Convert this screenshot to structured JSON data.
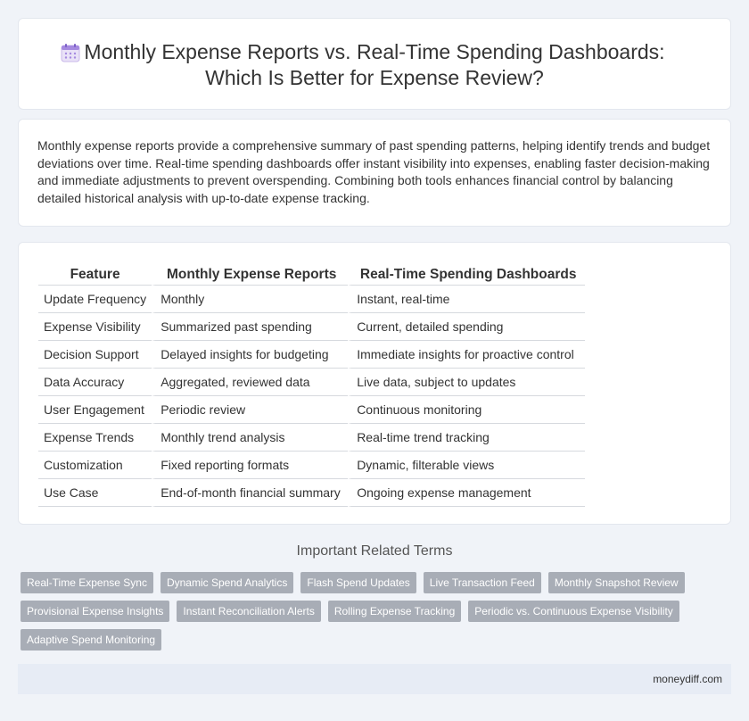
{
  "header": {
    "title_line1": "Monthly Expense Reports vs. Real-Time Spending Dashboards:",
    "title_line2": "Which Is Better for Expense Review?",
    "icon": "calendar-icon"
  },
  "intro": {
    "text": "Monthly expense reports provide a comprehensive summary of past spending patterns, helping identify trends and budget deviations over time. Real-time spending dashboards offer instant visibility into expenses, enabling faster decision-making and immediate adjustments to prevent overspending. Combining both tools enhances financial control by balancing detailed historical analysis with up-to-date expense tracking."
  },
  "table": {
    "headers": [
      "Feature",
      "Monthly Expense Reports",
      "Real-Time Spending Dashboards"
    ],
    "rows": [
      [
        "Update Frequency",
        "Monthly",
        "Instant, real-time"
      ],
      [
        "Expense Visibility",
        "Summarized past spending",
        "Current, detailed spending"
      ],
      [
        "Decision Support",
        "Delayed insights for budgeting",
        "Immediate insights for proactive control"
      ],
      [
        "Data Accuracy",
        "Aggregated, reviewed data",
        "Live data, subject to updates"
      ],
      [
        "User Engagement",
        "Periodic review",
        "Continuous monitoring"
      ],
      [
        "Expense Trends",
        "Monthly trend analysis",
        "Real-time trend tracking"
      ],
      [
        "Customization",
        "Fixed reporting formats",
        "Dynamic, filterable views"
      ],
      [
        "Use Case",
        "End-of-month financial summary",
        "Ongoing expense management"
      ]
    ]
  },
  "related": {
    "title": "Important Related Terms",
    "tags": [
      "Real-Time Expense Sync",
      "Dynamic Spend Analytics",
      "Flash Spend Updates",
      "Live Transaction Feed",
      "Monthly Snapshot Review",
      "Provisional Expense Insights",
      "Instant Reconciliation Alerts",
      "Rolling Expense Tracking",
      "Periodic vs. Continuous Expense Visibility",
      "Adaptive Spend Monitoring"
    ]
  },
  "footer": {
    "site": "moneydiff.com"
  },
  "colors": {
    "background": "#f0f3f8",
    "tag_background": "#a8adb6",
    "footer_background": "#e7ecf5"
  }
}
